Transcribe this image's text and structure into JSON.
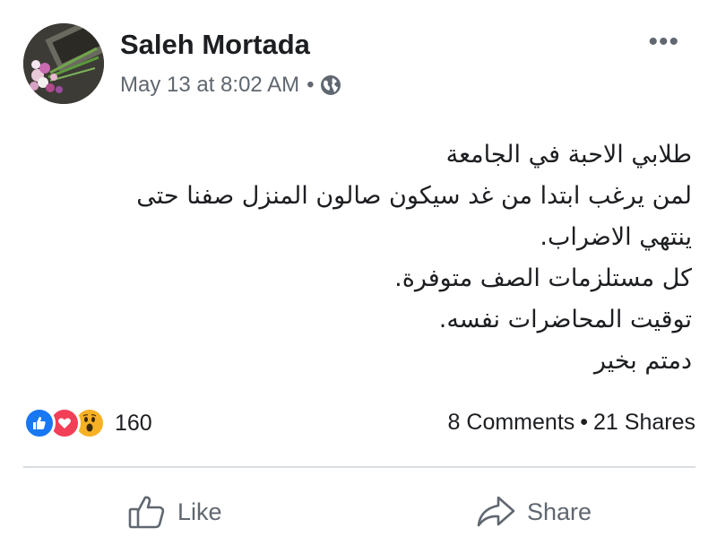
{
  "post": {
    "author": "Saleh Mortada",
    "timestamp": "May 13 at 8:02 AM",
    "separator": "•",
    "privacy_icon": "globe-icon",
    "more_icon": "•••",
    "text_lines": [
      "طلابي الاحبة في الجامعة",
      "لمن يرغب ابتدا من غد سيكون صالون المنزل صفنا حتى",
      "ينتهي الاضراب.",
      "كل مستلزمات الصف متوفرة.",
      "توقيت المحاضرات نفسه.",
      "دمتم بخير"
    ]
  },
  "stats": {
    "reactions": [
      "like",
      "love",
      "wow"
    ],
    "reaction_count": "160",
    "comments": "8 Comments",
    "dot": "•",
    "shares": "21 Shares"
  },
  "actions": {
    "like_label": "Like",
    "share_label": "Share"
  },
  "colors": {
    "like_blue": "#1877f2",
    "love_red": "#f33e58",
    "wow_yellow": "#f7b125",
    "secondary_text": "#606770"
  }
}
